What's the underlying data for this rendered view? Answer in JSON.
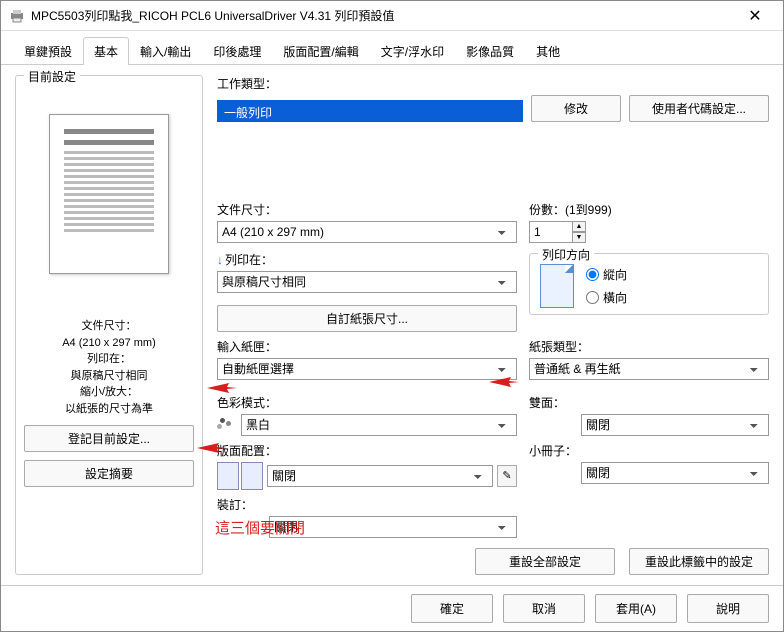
{
  "window": {
    "title": "MPC5503列印點我_RICOH PCL6 UniversalDriver V4.31 列印預設值"
  },
  "tabs": [
    "單鍵預設",
    "基本",
    "輸入/輸出",
    "印後處理",
    "版面配置/編輯",
    "文字/浮水印",
    "影像品質",
    "其他"
  ],
  "active_tab": 1,
  "left": {
    "group_title": "目前設定",
    "info": {
      "doc_size_label": "文件尺寸：",
      "doc_size_value": "A4 (210 x 297 mm)",
      "print_on_label": "列印在：",
      "print_on_value": "與原稿尺寸相同",
      "zoom_label": "縮小/放大：",
      "zoom_value": "以紙張的尺寸為準"
    },
    "btn_register": "登記目前設定...",
    "btn_summary": "設定摘要"
  },
  "main": {
    "job_type_label": "工作類型：",
    "job_type_value": "一般列印",
    "btn_modify": "修改",
    "btn_usercode": "使用者代碼設定...",
    "doc_size_label": "文件尺寸：",
    "doc_size_value": "A4 (210 x 297 mm)",
    "print_on_label": "列印在：",
    "print_on_value": "與原稿尺寸相同",
    "btn_custom_size": "自訂紙張尺寸...",
    "tray_label": "輸入紙匣：",
    "tray_value": "自動紙匣選擇",
    "copies_label": "份數：(1到999)",
    "copies_value": "1",
    "orientation": {
      "title": "列印方向",
      "portrait": "縱向",
      "landscape": "橫向",
      "value": "portrait"
    },
    "paper_type_label": "紙張類型：",
    "paper_type_value": "普通紙 & 再生紙",
    "color_label": "色彩模式：",
    "color_value": "黑白",
    "duplex_label": "雙面：",
    "duplex_value": "關閉",
    "layout_label": "版面配置：",
    "layout_value": "關閉",
    "booklet_label": "小冊子：",
    "booklet_value": "關閉",
    "binding_label": "裝訂：",
    "binding_value": "關閉",
    "btn_reset_all": "重設全部設定",
    "btn_reset_tab": "重設此標籤中的設定"
  },
  "annotation": {
    "text": "這三個要關閉"
  },
  "footer": {
    "ok": "確定",
    "cancel": "取消",
    "apply": "套用(A)",
    "help": "說明"
  }
}
